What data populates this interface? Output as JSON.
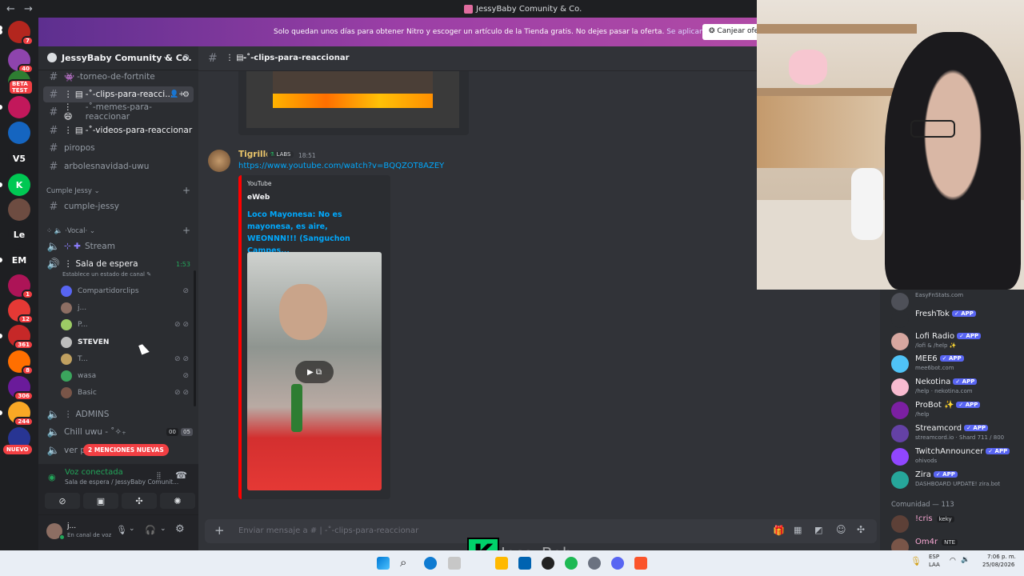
{
  "window": {
    "title": "JessyBaby Comunity & Co."
  },
  "nitro_banner": {
    "message": "Solo quedan unos días para obtener Nitro y escoger un artículo de la Tienda gratis. No dejes pasar la oferta.",
    "link": "Se aplican condiciones.",
    "button": "Canjear ofe"
  },
  "guilds": [
    {
      "label": "",
      "color": "#b3261e",
      "badge": "7"
    },
    {
      "label": "",
      "color": "#8e44ad",
      "badge": "40"
    },
    {
      "label": "",
      "color": "#2e7d32",
      "badge": "BETA TEST"
    },
    {
      "label": "",
      "color": "#c2185b",
      "badge": ""
    },
    {
      "label": "",
      "color": "#1565c0",
      "badge": ""
    },
    {
      "label": "V5",
      "color": "#1e1f22",
      "badge": ""
    },
    {
      "label": "K",
      "color": "#00c853",
      "badge": ""
    },
    {
      "label": "",
      "color": "#6d4c41",
      "badge": ""
    },
    {
      "label": "Le",
      "color": "#1e1f22",
      "badge": ""
    },
    {
      "label": "EM",
      "color": "#1e1f22",
      "badge": ""
    },
    {
      "label": "",
      "color": "#ad1457",
      "badge": "1"
    },
    {
      "label": "",
      "color": "#e53935",
      "badge": "12"
    },
    {
      "label": "",
      "color": "#c62828",
      "badge": "361"
    },
    {
      "label": "",
      "color": "#ff6f00",
      "badge": "8"
    },
    {
      "label": "",
      "color": "#6a1b9a",
      "badge": "306"
    },
    {
      "label": "",
      "color": "#f9a825",
      "badge": "244"
    },
    {
      "label": "",
      "color": "#283593",
      "badge": ""
    }
  ],
  "guilds_new_label": "NUEVO",
  "server": {
    "name": "JessyBaby Comunity & Co."
  },
  "channels": [
    {
      "name": "-torneo-de-fortnite",
      "state": ""
    },
    {
      "name": "-˚-clips-para-reacci...",
      "state": "active"
    },
    {
      "name": "-˚-memes-para-reaccionar",
      "state": ""
    },
    {
      "name": "-˚-videos-para-reaccionar",
      "state": "bright"
    },
    {
      "name": "piropos",
      "state": ""
    },
    {
      "name": "arbolesnavidad-uwu",
      "state": ""
    }
  ],
  "category_cumple": "Cumple Jessy",
  "channel_cumple": "cumple-jessy",
  "category_vocal": "Vocal",
  "voice_stream": "Stream",
  "voice_sala": {
    "name": "Sala de espera",
    "time": "1:53",
    "status": "Establece un estado de canal"
  },
  "voice_users": [
    {
      "name": "Compartidorclips",
      "color": "#5865f2"
    },
    {
      "name": "j...",
      "color": "#8d6e63"
    },
    {
      "name": "P...",
      "color": "#9ccc65"
    },
    {
      "name": "STEVEN",
      "color": "#bdbdbd"
    },
    {
      "name": "T...",
      "color": "#c0a060"
    },
    {
      "name": "wasa",
      "color": "#3ba55d"
    },
    {
      "name": "Basic",
      "color": "#795548"
    }
  ],
  "channel_admins": "ADMINS",
  "channel_chill": "Chill uwu -",
  "channel_chill_counts": [
    "00",
    "05"
  ],
  "channel_ver": "ver p",
  "mentions_badge": "2 MENCIONES NUEVAS",
  "voice_panel": {
    "status": "Voz conectada",
    "location": "Sala de espera / JessyBaby Comunit..."
  },
  "user_panel": {
    "name": "j...",
    "status": "En canal de voz"
  },
  "chat_header": {
    "channel": "-˚-clips-para-reaccionar"
  },
  "message": {
    "author": "Tigrillo",
    "tag": "LABS",
    "time": "18:51",
    "link": "https://www.youtube.com/watch?v=BQQZOT8AZEY",
    "embed_provider": "YouTube",
    "embed_author": "eWeb",
    "embed_title": "Loco Mayonesa: No es mayonesa, es aire, WEONNN!!! (Sanguchon Campes..."
  },
  "composer": {
    "placeholder": "Enviar mensaje a # | -˚-clips-para-reaccionar"
  },
  "members": [
    {
      "name": "",
      "status": "EasyFnStats.com",
      "app": false,
      "color": "#4e5058"
    },
    {
      "name": "FreshTok",
      "status": "",
      "app": true,
      "color": "#2b2d31"
    },
    {
      "name": "Lofi Radio",
      "status": "/lofi & /help ✨",
      "app": true,
      "color": "#d7a7a0"
    },
    {
      "name": "MEE6",
      "status": "mee6bot.com",
      "app": true,
      "color": "#4fc3f7"
    },
    {
      "name": "Nekotina",
      "status": "/help · nekotina.com",
      "app": true,
      "color": "#f8bbd0"
    },
    {
      "name": "ProBot ✨",
      "status": "/help",
      "app": true,
      "color": "#7b1fa2"
    },
    {
      "name": "Streamcord",
      "status": "streamcord.io · Shard 711 / 800",
      "app": true,
      "color": "#6441a5"
    },
    {
      "name": "TwitchAnnouncer",
      "status": "ohivods",
      "app": true,
      "color": "#9146ff"
    },
    {
      "name": "Zira",
      "status": "DASHBOARD UPDATE! zira.bot",
      "app": true,
      "color": "#26a69a"
    }
  ],
  "members_section": "Comunidad — 113",
  "community_members": [
    {
      "name": "!cris",
      "status": "",
      "role": "keky",
      "color": "#5d4037"
    },
    {
      "name": "Om4r",
      "status": "",
      "role": "NTE",
      "color": "#795548"
    }
  ],
  "stream_overlay": "JessyBaby",
  "taskbar": {
    "lang": "ESP",
    "lang2": "LAA",
    "time": "7:06 p. m.",
    "date": "25/08/2026"
  }
}
